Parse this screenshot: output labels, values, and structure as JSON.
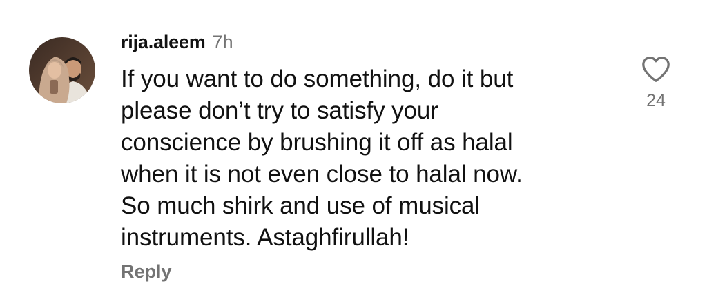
{
  "comment": {
    "avatar_icon": "profile-photo-avatar",
    "username": "rija.aleem",
    "timestamp": "7h",
    "text": "If you want to do something, do it but\nplease don’t try to satisfy your\nconscience by brushing it off as halal\nwhen it is not even close to halal now.\nSo much shirk and use of musical\ninstruments. Astaghfirullah!",
    "reply_label": "Reply",
    "like_icon": "heart-outline-icon",
    "like_count": "24"
  },
  "colors": {
    "text": "#111111",
    "secondary": "#737373",
    "background": "#ffffff"
  }
}
